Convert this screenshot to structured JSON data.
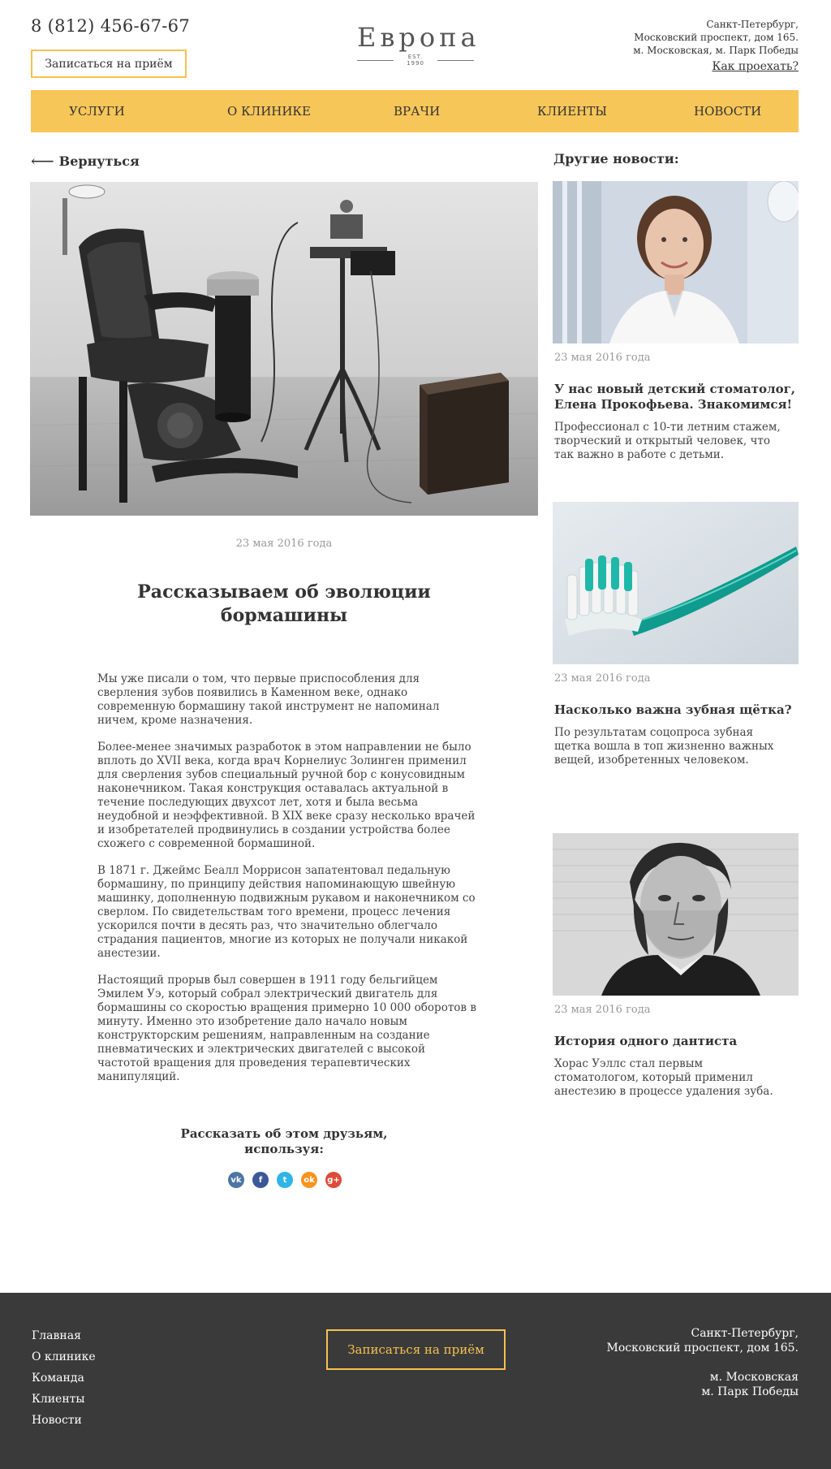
{
  "header": {
    "phone": "8 (812) 456-67-67",
    "appoint_label": "Записаться на приём",
    "logo_word": "Европа",
    "logo_sub": "EST. 1990",
    "address_lines": [
      "Санкт-Петербург,",
      "Московский проспект, дом 165.",
      "м. Московская, м. Парк Победы"
    ],
    "route_label": "Как проехать?"
  },
  "nav": {
    "items": [
      "Услуги",
      "О клинике",
      "Врачи",
      "Клиенты",
      "Новости"
    ]
  },
  "article": {
    "back_label": "Вернуться",
    "date": "23 мая 2016 года",
    "title": "Рассказываем об эволюции бормашины",
    "paragraphs": [
      "Мы уже писали о том, что первые приспособления для сверления зубов появились в Каменном веке, однако современную бормашину такой инструмент не напоминал ничем, кроме назначения.",
      "Более-менее значимых разработок в этом направлении не было вплоть до XVII века, когда врач Корнелиус Золинген применил для сверления зубов специальный ручной бор с конусовидным наконечником. Такая конструкция оставалась актуальной в течение последующих двухсот лет, хотя и была весьма неудобной и неэффективной. В XIX веке сразу несколько врачей и изобретателей продвинулись в создании устройства более схожего с современной бормашиной.",
      "В 1871 г. Джеймс Беалл Моррисон запатентовал педальную бормашину, по принципу действия напоминающую швейную машинку, дополненную подвижным рукавом и наконечником со сверлом. По свидетельствам того времени, процесс лечения ускорился почти в десять раз, что значительно облегчало страдания пациентов, многие из которых не получали никакой анестезии.",
      "Настоящий прорыв был совершен в 1911 году бельгийцем Эмилем Уэ, который собрал электрический двигатель для бормашины со скоростью вращения примерно 10 000 оборотов в минуту. Именно это изобретение дало начало новым конструкторским решениям, направленным на создание пневматических и электрических двигателей с высокой частотой вращения для проведения терапевтических манипуляций."
    ],
    "share_title": "Рассказать об этом друзьям, используя:",
    "share_icons": [
      {
        "name": "vk-icon",
        "glyph": "vk",
        "color": "#4c75a3"
      },
      {
        "name": "facebook-icon",
        "glyph": "f",
        "color": "#3b5998"
      },
      {
        "name": "twitter-icon",
        "glyph": "t",
        "color": "#2fb4e9"
      },
      {
        "name": "odnoklassniki-icon",
        "glyph": "ok",
        "color": "#f7931e"
      },
      {
        "name": "google-plus-icon",
        "glyph": "g+",
        "color": "#dd4b39"
      }
    ]
  },
  "sidebar": {
    "title": "Другие новости:",
    "news": [
      {
        "date": "23 мая 2016 года",
        "title": "У нас новый детский стоматолог, Елена Прокофьева. Знакомимся!",
        "text": "Профессионал с 10-ти летним стажем, творческий и открытый человек, что так важно в работе с детьми."
      },
      {
        "date": "23 мая 2016 года",
        "title": "Насколько важна зубная щётка?",
        "text": "По результатам соцопроса зубная щетка вошла в топ жизненно важных вещей, изобретенных человеком."
      },
      {
        "date": "23 мая 2016 года",
        "title": "История одного дантиста",
        "text": "Хорас Уэллс стал первым стоматологом, который применил анестезию в процессе удаления зуба."
      }
    ]
  },
  "footer": {
    "nav": [
      "Главная",
      "О клинике",
      "Команда",
      "Клиенты",
      "Новости"
    ],
    "appoint_label": "Записаться на приём",
    "address_lines": [
      "Санкт-Петербург,",
      "Московский проспект, дом 165."
    ],
    "metro_lines": [
      "м. Московская",
      "м. Парк Победы"
    ]
  },
  "colors": {
    "accent": "#f7c659",
    "footer_bg": "#3a3a3a",
    "muted_text": "#999999"
  }
}
